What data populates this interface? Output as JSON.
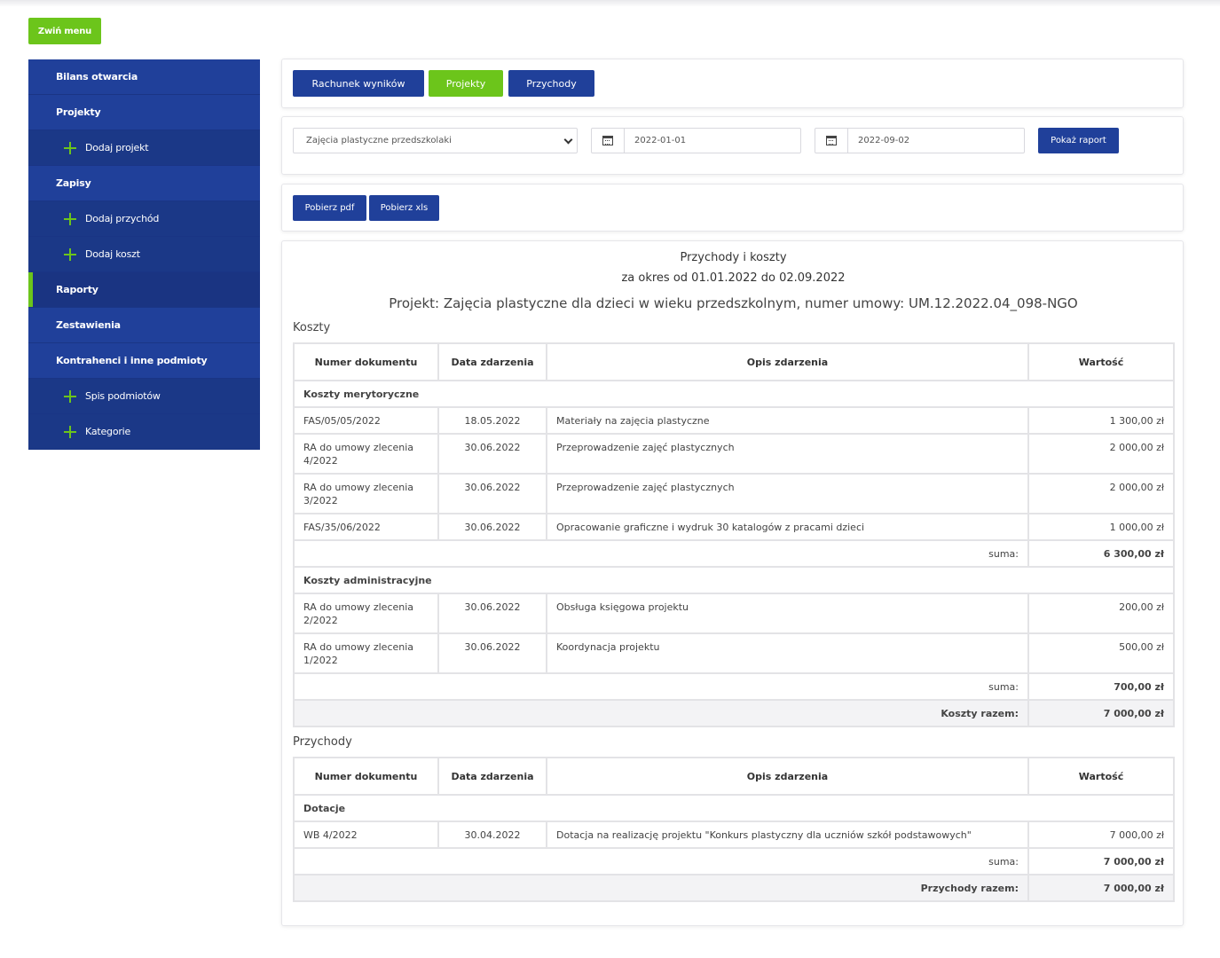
{
  "toggle_menu": "Zwiń menu",
  "sidebar": {
    "items": [
      {
        "label": "Bilans otwarcia",
        "sub": false,
        "active": false
      },
      {
        "label": "Projekty",
        "sub": false,
        "active": false
      },
      {
        "label": "Dodaj projekt",
        "sub": true,
        "active": false
      },
      {
        "label": "Zapisy",
        "sub": false,
        "active": false
      },
      {
        "label": "Dodaj przychód",
        "sub": true,
        "active": false
      },
      {
        "label": "Dodaj koszt",
        "sub": true,
        "active": false
      },
      {
        "label": "Raporty",
        "sub": false,
        "active": true
      },
      {
        "label": "Zestawienia",
        "sub": false,
        "active": false
      },
      {
        "label": "Kontrahenci i inne podmioty",
        "sub": false,
        "active": false
      },
      {
        "label": "Spis podmiotów",
        "sub": true,
        "active": false
      },
      {
        "label": "Kategorie",
        "sub": true,
        "active": false
      }
    ]
  },
  "tabs": {
    "results": "Rachunek wyników",
    "projects": "Projekty",
    "income": "Przychody"
  },
  "filters": {
    "project_select": "Zajęcia plastyczne przedszkolaki",
    "date_from": "2022-01-01",
    "date_to": "2022-09-02",
    "show_report": "Pokaż raport"
  },
  "downloads": {
    "pdf": "Pobierz pdf",
    "xls": "Pobierz xls"
  },
  "report": {
    "title": "Przychody i koszty",
    "period": "za okres od 01.01.2022 do 02.09.2022",
    "project": "Projekt: Zajęcia plastyczne dla dzieci w wieku przedszkolnym, numer umowy: UM.12.2022.04_098-NGO",
    "headers": {
      "number": "Numer dokumentu",
      "date": "Data zdarzenia",
      "description": "Opis zdarzenia",
      "value": "Wartość"
    },
    "costs": {
      "label": "Koszty",
      "groups": [
        {
          "name": "Koszty merytoryczne",
          "rows": [
            {
              "number": "FAS/05/05/2022",
              "date": "18.05.2022",
              "description": "Materiały na zajęcia plastyczne",
              "value": "1 300,00 zł"
            },
            {
              "number": "RA do umowy zlecenia 4/2022",
              "date": "30.06.2022",
              "description": "Przeprowadzenie zajęć plastycznych",
              "value": "2 000,00 zł"
            },
            {
              "number": "RA do umowy zlecenia 3/2022",
              "date": "30.06.2022",
              "description": "Przeprowadzenie zajęć plastycznych",
              "value": "2 000,00 zł"
            },
            {
              "number": "FAS/35/06/2022",
              "date": "30.06.2022",
              "description": "Opracowanie graficzne i wydruk 30 katalogów z pracami dzieci",
              "value": "1 000,00 zł"
            }
          ],
          "sum_label": "suma:",
          "sum": "6 300,00 zł"
        },
        {
          "name": "Koszty administracyjne",
          "rows": [
            {
              "number": "RA do umowy zlecenia 2/2022",
              "date": "30.06.2022",
              "description": "Obsługa księgowa projektu",
              "value": "200,00 zł"
            },
            {
              "number": "RA do umowy zlecenia 1/2022",
              "date": "30.06.2022",
              "description": "Koordynacja projektu",
              "value": "500,00 zł"
            }
          ],
          "sum_label": "suma:",
          "sum": "700,00 zł"
        }
      ],
      "total_label": "Koszty razem:",
      "total": "7 000,00 zł"
    },
    "income": {
      "label": "Przychody",
      "groups": [
        {
          "name": "Dotacje",
          "rows": [
            {
              "number": "WB 4/2022",
              "date": "30.04.2022",
              "description": "Dotacja na realizację projektu \"Konkurs plastyczny dla uczniów szkół podstawowych\"",
              "value": "7 000,00 zł"
            }
          ],
          "sum_label": "suma:",
          "sum": "7 000,00 zł"
        }
      ],
      "total_label": "Przychody razem:",
      "total": "7 000,00 zł"
    }
  },
  "colors": {
    "primary": "#20409a",
    "accent": "#6cc51b"
  }
}
